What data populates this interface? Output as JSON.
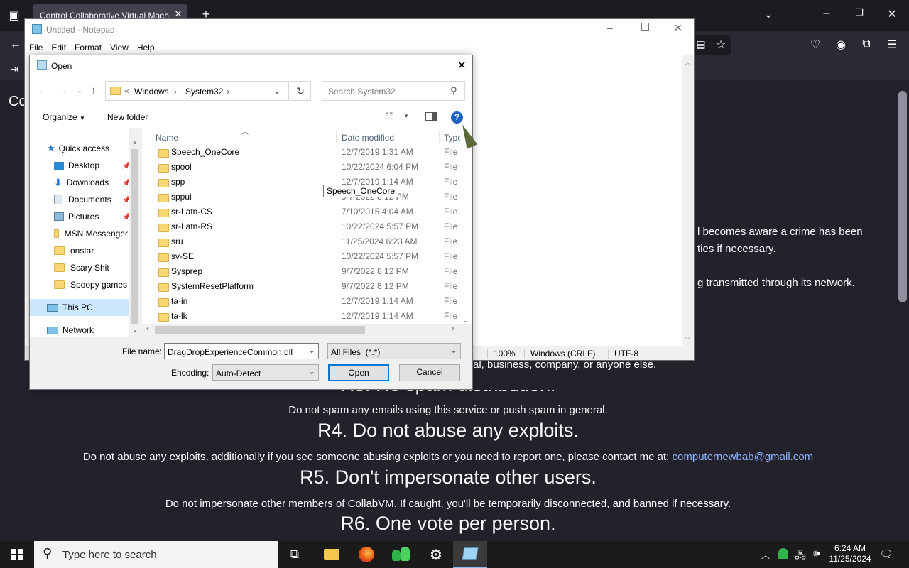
{
  "browser": {
    "tab_title": "Control Collaborative Virtual Mach",
    "page_partial_title": "Co",
    "partial_lines": [
      "l becomes aware a crime has been",
      "ties if necessary.",
      "g transmitted through its network."
    ],
    "line_business": "al, business, company, or anyone else.",
    "rule3_title": "R3. No spam distribution.",
    "rule3_text": "Do not spam any emails using this service or push spam in general.",
    "rule4_title": "R4. Do not abuse any exploits.",
    "rule4_text": "Do not abuse any exploits, additionally if you see someone abusing exploits or you need to report one, please contact me at:",
    "rule4_link": "computernewbab@gmail.com",
    "rule5_title": "R5. Don't impersonate other users.",
    "rule5_text": "Do not impersonate other members of CollabVM. If caught, you'll be temporarily disconnected, and banned if necessary.",
    "rule6_title": "R6. One vote per person."
  },
  "notepad": {
    "title": "Untitled - Notepad",
    "menu": [
      "File",
      "Edit",
      "Format",
      "View",
      "Help"
    ],
    "status": {
      "zoom": "100%",
      "eol": "Windows (CRLF)",
      "encoding": "UTF-8"
    }
  },
  "dialog": {
    "title": "Open",
    "breadcrumb": {
      "prefix": "«",
      "parts": [
        "Windows",
        "System32"
      ]
    },
    "search_placeholder": "Search System32",
    "organize": "Organize",
    "new_folder": "New folder",
    "nav": [
      {
        "label": "Quick access",
        "pinned": false
      },
      {
        "label": "Desktop",
        "pinned": true
      },
      {
        "label": "Downloads",
        "pinned": true
      },
      {
        "label": "Documents",
        "pinned": true
      },
      {
        "label": "Pictures",
        "pinned": true
      },
      {
        "label": "MSN Messenger",
        "pinned": false
      },
      {
        "label": "onstar",
        "pinned": false
      },
      {
        "label": "Scary Shit",
        "pinned": false
      },
      {
        "label": "Spoopy games",
        "pinned": false
      },
      {
        "label": "This PC",
        "pinned": false
      },
      {
        "label": "Network",
        "pinned": false
      }
    ],
    "columns": {
      "name": "Name",
      "date": "Date modified",
      "type": "Type"
    },
    "files": [
      {
        "name": "Speech_OneCore",
        "date": "12/7/2019 1:31 AM",
        "type": "File f"
      },
      {
        "name": "spool",
        "date": "10/22/2024 6:04 PM",
        "type": "File f"
      },
      {
        "name": "spp",
        "date": "12/7/2019 1:14 AM",
        "type": "File f"
      },
      {
        "name": "sppui",
        "date": "9/7/2022 8:12 PM",
        "type": "File f"
      },
      {
        "name": "sr-Latn-CS",
        "date": "7/10/2015 4:04 AM",
        "type": "File f"
      },
      {
        "name": "sr-Latn-RS",
        "date": "10/22/2024 5:57 PM",
        "type": "File f"
      },
      {
        "name": "sru",
        "date": "11/25/2024 6:23 AM",
        "type": "File f"
      },
      {
        "name": "sv-SE",
        "date": "10/22/2024 5:57 PM",
        "type": "File f"
      },
      {
        "name": "Sysprep",
        "date": "9/7/2022 8:12 PM",
        "type": "File f"
      },
      {
        "name": "SystemResetPlatform",
        "date": "9/7/2022 8:12 PM",
        "type": "File f"
      },
      {
        "name": "ta-in",
        "date": "12/7/2019 1:14 AM",
        "type": "File f"
      },
      {
        "name": "ta-lk",
        "date": "12/7/2019 1:14 AM",
        "type": "File f"
      }
    ],
    "tooltip": "Speech_OneCore",
    "file_name_label": "File name:",
    "file_name_value": "DragDropExperienceCommon.dll",
    "file_type": "All Files  (*.*)",
    "encoding_label": "Encoding:",
    "encoding_value": "Auto-Detect",
    "open_button": "Open",
    "cancel_button": "Cancel"
  },
  "taskbar": {
    "search_placeholder": "Type here to search",
    "time": "6:24 AM",
    "date": "11/25/2024"
  }
}
